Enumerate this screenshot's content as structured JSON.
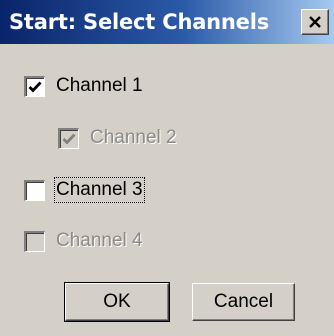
{
  "window": {
    "title": "Start: Select Channels",
    "close_icon": "close-icon"
  },
  "channels": [
    {
      "label": "Channel 1",
      "checked": true,
      "enabled": true
    },
    {
      "label": "Channel 2",
      "checked": true,
      "enabled": false
    },
    {
      "label": "Channel 3",
      "checked": false,
      "enabled": true,
      "focused": true
    },
    {
      "label": "Channel 4",
      "checked": false,
      "enabled": false
    }
  ],
  "buttons": {
    "ok_label": "OK",
    "cancel_label": "Cancel"
  },
  "colors": {
    "dialog_face": "#d4d0c8",
    "titlebar_start": "#0a246a",
    "titlebar_end": "#a6caf0",
    "disabled_text": "#8c8a86"
  }
}
